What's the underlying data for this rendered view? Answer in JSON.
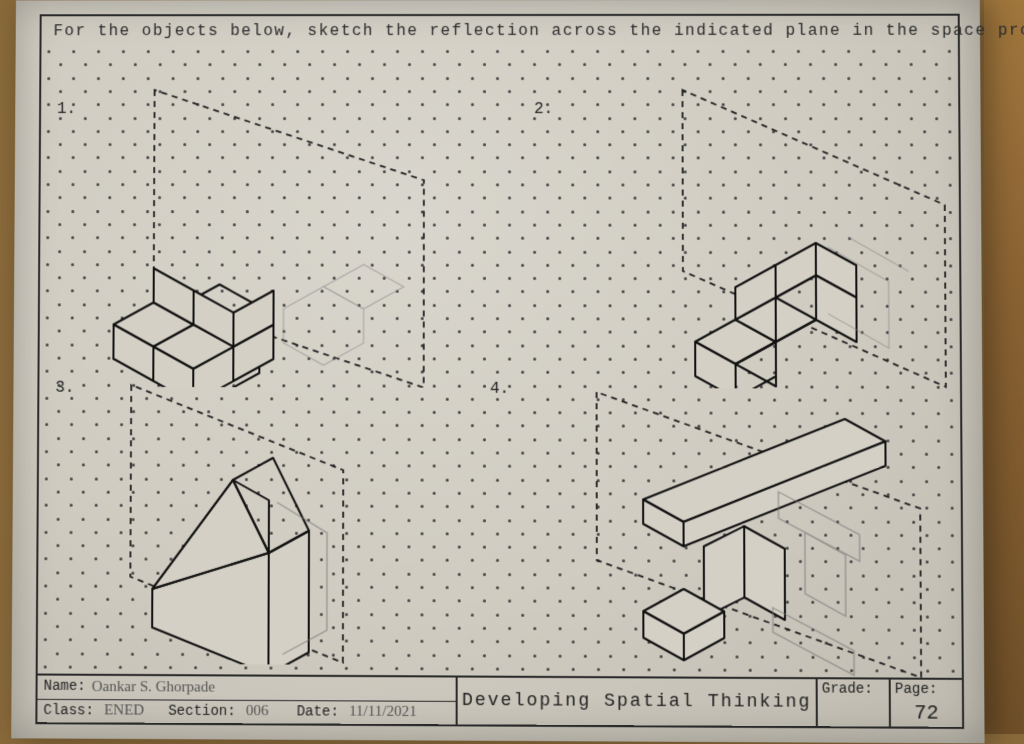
{
  "instruction": "For the objects below, sketch the reflection across the indicated plane in the space provided.",
  "questions": {
    "q1": "1.",
    "q2": "2.",
    "q3": "3.",
    "q4": "4."
  },
  "title_block": {
    "name_label": "Name:",
    "name_value": "Oankar S. Ghorpade",
    "class_label": "Class:",
    "class_value": "ENED",
    "section_label": "Section:",
    "section_value": "006",
    "date_label": "Date:",
    "date_value": "11/11/2021",
    "center_title": "Developing Spatial Thinking",
    "grade_label": "Grade:",
    "grade_value": "",
    "page_label": "Page:",
    "page_value": "72"
  }
}
